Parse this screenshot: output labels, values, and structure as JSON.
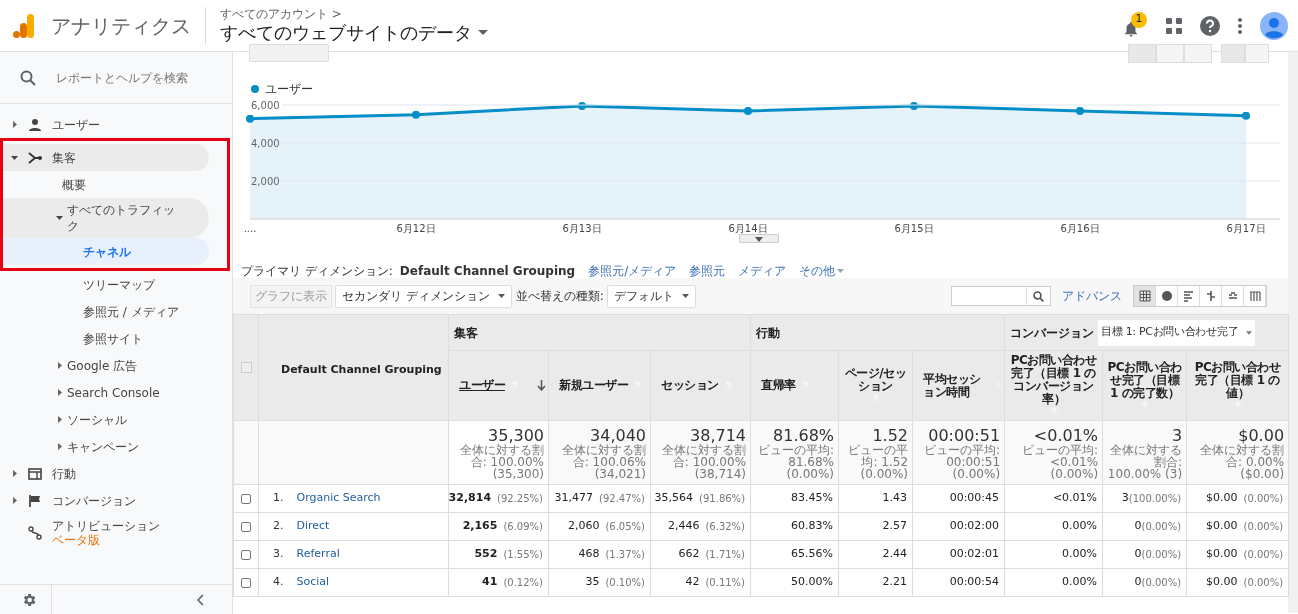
{
  "header": {
    "product": "アナリティクス",
    "breadcrumb": "すべてのアカウント >",
    "property": "すべてのウェブサイトのデータ",
    "notification_count": "1"
  },
  "sidebar": {
    "search_placeholder": "レポートとヘルプを検索",
    "items": [
      {
        "label": "ユーザー",
        "expanded": false,
        "selected": false,
        "boxed": false,
        "has_children": true
      },
      {
        "label": "集客",
        "expanded": true,
        "selected": false,
        "boxed": true,
        "has_children": true,
        "children": [
          {
            "label": "概要",
            "selected": false,
            "boxed": true
          },
          {
            "label": "すべてのトラフィック",
            "expanded": true,
            "selected": false,
            "boxed": true,
            "has_children": true,
            "children": [
              {
                "label": "チャネル",
                "selected": true,
                "boxed": true
              },
              {
                "label": "ツリーマップ",
                "selected": false,
                "boxed": false
              },
              {
                "label": "参照元 / メディア",
                "selected": false,
                "boxed": false
              },
              {
                "label": "参照サイト",
                "selected": false,
                "boxed": false
              }
            ]
          },
          {
            "label": "Google 広告",
            "expanded": false,
            "selected": false,
            "boxed": false,
            "has_children": true
          },
          {
            "label": "Search Console",
            "expanded": false,
            "selected": false,
            "boxed": false,
            "has_children": true
          },
          {
            "label": "ソーシャル",
            "expanded": false,
            "selected": false,
            "boxed": false,
            "has_children": true
          },
          {
            "label": "キャンペーン",
            "expanded": false,
            "selected": false,
            "boxed": false,
            "has_children": true
          }
        ]
      },
      {
        "label": "行動",
        "expanded": false,
        "selected": false,
        "boxed": false,
        "has_children": true
      },
      {
        "label": "コンバージョン",
        "expanded": false,
        "selected": false,
        "boxed": false,
        "has_children": true
      },
      {
        "label": "アトリビューション",
        "badge": "ベータ版",
        "expanded": false,
        "selected": false,
        "boxed": false,
        "has_children": false
      }
    ]
  },
  "chart": {
    "chart_data": {
      "type": "line",
      "categories": [
        "....",
        "6月12日",
        "6月13日",
        "6月14日",
        "6月15日",
        "6月16日",
        "6月17日"
      ],
      "series": [
        {
          "name": "ユーザー",
          "color": "#058dc7",
          "values": [
            5280,
            5490,
            5950,
            5690,
            5950,
            5690,
            5440
          ]
        }
      ],
      "ylim": [
        0,
        6000
      ],
      "yticks": [
        {
          "value": 2000,
          "label": "2,000"
        },
        {
          "value": 4000,
          "label": "4,000"
        },
        {
          "value": 6000,
          "label": "6,000"
        }
      ]
    }
  },
  "primary_dimension": {
    "label": "プライマリ ディメンション:",
    "options": [
      {
        "label": "Default Channel Grouping",
        "selected": true
      },
      {
        "label": "参照元/メディア",
        "selected": false
      },
      {
        "label": "参照元",
        "selected": false
      },
      {
        "label": "メディア",
        "selected": false
      },
      {
        "label": "その他",
        "selected": false,
        "menu": true
      }
    ]
  },
  "toolbar": {
    "chart_button": {
      "label": "グラフに表示",
      "disabled": true
    },
    "secondary_dimension": "セカンダリ ディメンション",
    "sort_label": "並べ替えの種類:",
    "sort_value": "デフォルト",
    "advanced": "アドバンス",
    "views": [
      {
        "kind": "table",
        "selected": true
      },
      {
        "kind": "pie",
        "selected": false
      },
      {
        "kind": "bars",
        "selected": false
      },
      {
        "kind": "compare",
        "selected": false
      },
      {
        "kind": "term",
        "selected": false
      },
      {
        "kind": "pivot",
        "selected": false
      }
    ]
  },
  "table": {
    "all_checked": false,
    "dimension_header": "Default Channel Grouping",
    "groups": [
      {
        "label": "集客"
      },
      {
        "label": "行動"
      },
      {
        "label": "コンバージョン",
        "goal": "目標 1: PCお問い合わせ完了"
      }
    ],
    "columns": [
      {
        "label": "ユーザー",
        "sorted": true
      },
      {
        "label": "新規ユーザー",
        "sorted": false
      },
      {
        "label": "セッション",
        "sorted": false
      },
      {
        "label": "直帰率",
        "sorted": false
      },
      {
        "label": "ページ/セッション",
        "sorted": false
      },
      {
        "label": "平均セッション時間",
        "sorted": false
      },
      {
        "label": "PCお問い合わせ完了（目標 1 のコンバージョン率）",
        "sorted": false
      },
      {
        "label": "PCお問い合わせ完了（目標 1 の完了数）",
        "sorted": false
      },
      {
        "label": "PCお問い合わせ完了（目標 1 の値）",
        "sorted": false
      }
    ],
    "totals": [
      {
        "value": "35,300",
        "note": "全体に対する割合: 100.00% (35,300)"
      },
      {
        "value": "34,040",
        "note": "全体に対する割合: 100.06% (34,021)"
      },
      {
        "value": "38,714",
        "note": "全体に対する割合: 100.00% (38,714)"
      },
      {
        "value": "81.68%",
        "note": "ビューの平均: 81.68% (0.00%)"
      },
      {
        "value": "1.52",
        "note": "ビューの平均: 1.52 (0.00%)"
      },
      {
        "value": "00:00:51",
        "note": "ビューの平均: 00:00:51 (0.00%)"
      },
      {
        "value": "<0.01%",
        "note": "ビューの平均: <0.01% (0.00%)"
      },
      {
        "value": "3",
        "note": "全体に対する割合: 100.00% (3)"
      },
      {
        "value": "$0.00",
        "note": "全体に対する割合: 0.00% ($0.00)"
      }
    ],
    "rows": [
      {
        "index": "1.",
        "name": "Organic Search",
        "checked": false,
        "cells": [
          {
            "value": "32,814",
            "percent": "(92.25%)"
          },
          {
            "value": "31,477",
            "percent": "(92.47%)"
          },
          {
            "value": "35,564",
            "percent": "(91.86%)"
          },
          {
            "value": "83.45%"
          },
          {
            "value": "1.43"
          },
          {
            "value": "00:00:45"
          },
          {
            "value": "<0.01%"
          },
          {
            "value": "3",
            "percent": "(100.00%)"
          },
          {
            "value": "$0.00",
            "percent": "(0.00%)"
          }
        ]
      },
      {
        "index": "2.",
        "name": "Direct",
        "checked": false,
        "cells": [
          {
            "value": "2,165",
            "percent": "(6.09%)"
          },
          {
            "value": "2,060",
            "percent": "(6.05%)"
          },
          {
            "value": "2,446",
            "percent": "(6.32%)"
          },
          {
            "value": "60.83%"
          },
          {
            "value": "2.57"
          },
          {
            "value": "00:02:00"
          },
          {
            "value": "0.00%"
          },
          {
            "value": "0",
            "percent": "(0.00%)"
          },
          {
            "value": "$0.00",
            "percent": "(0.00%)"
          }
        ]
      },
      {
        "index": "3.",
        "name": "Referral",
        "checked": false,
        "cells": [
          {
            "value": "552",
            "percent": "(1.55%)"
          },
          {
            "value": "468",
            "percent": "(1.37%)"
          },
          {
            "value": "662",
            "percent": "(1.71%)"
          },
          {
            "value": "65.56%"
          },
          {
            "value": "2.44"
          },
          {
            "value": "00:02:01"
          },
          {
            "value": "0.00%"
          },
          {
            "value": "0",
            "percent": "(0.00%)"
          },
          {
            "value": "$0.00",
            "percent": "(0.00%)"
          }
        ]
      },
      {
        "index": "4.",
        "name": "Social",
        "checked": false,
        "cells": [
          {
            "value": "41",
            "percent": "(0.12%)"
          },
          {
            "value": "35",
            "percent": "(0.10%)"
          },
          {
            "value": "42",
            "percent": "(0.11%)"
          },
          {
            "value": "50.00%"
          },
          {
            "value": "2.21"
          },
          {
            "value": "00:00:54"
          },
          {
            "value": "0.00%"
          },
          {
            "value": "0",
            "percent": "(0.00%)"
          },
          {
            "value": "$0.00",
            "percent": "(0.00%)"
          }
        ]
      }
    ]
  }
}
